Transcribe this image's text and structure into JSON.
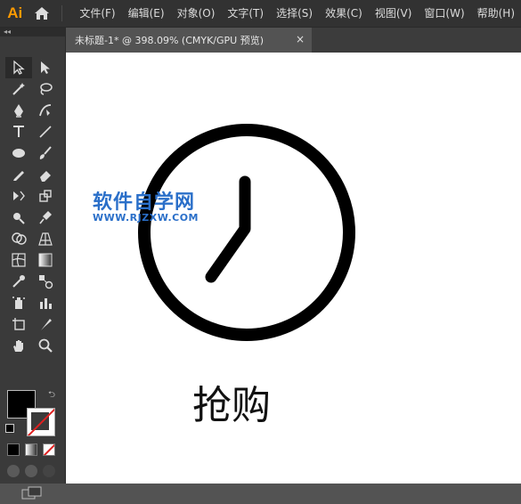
{
  "app": {
    "logo_text": "Ai"
  },
  "menu": {
    "items": [
      "文件(F)",
      "编辑(E)",
      "对象(O)",
      "文字(T)",
      "选择(S)",
      "效果(C)",
      "视图(V)",
      "窗口(W)",
      "帮助(H)"
    ]
  },
  "document_tab": {
    "label": "未标题-1* @ 398.09% (CMYK/GPU 预览)",
    "close": "×"
  },
  "toolbar": {
    "collapse": "◂◂",
    "tools": [
      "selection-tool",
      "direct-selection-tool",
      "magic-wand-tool",
      "lasso-tool",
      "pen-tool",
      "curvature-tool",
      "type-tool",
      "line-segment-tool",
      "ellipse-tool",
      "paintbrush-tool",
      "pencil-tool",
      "eraser-tool",
      "rotate-tool",
      "scale-tool",
      "warp-tool",
      "puppet-warp-tool",
      "shape-builder-tool",
      "perspective-grid-tool",
      "mesh-tool",
      "gradient-tool",
      "eyedropper-tool",
      "blend-tool",
      "symbol-sprayer-tool",
      "column-graph-tool",
      "artboard-tool",
      "slice-tool",
      "hand-tool",
      "zoom-tool"
    ],
    "fill_color": "#000000",
    "stroke_color": "none"
  },
  "canvas": {
    "watermark_title": "软件自学网",
    "watermark_url": "WWW.RJZXW.COM",
    "caption": "抢购",
    "icon": "clock-icon"
  },
  "colors": {
    "accent_logo": "#ff9a00",
    "watermark": "#2a6fc9"
  }
}
